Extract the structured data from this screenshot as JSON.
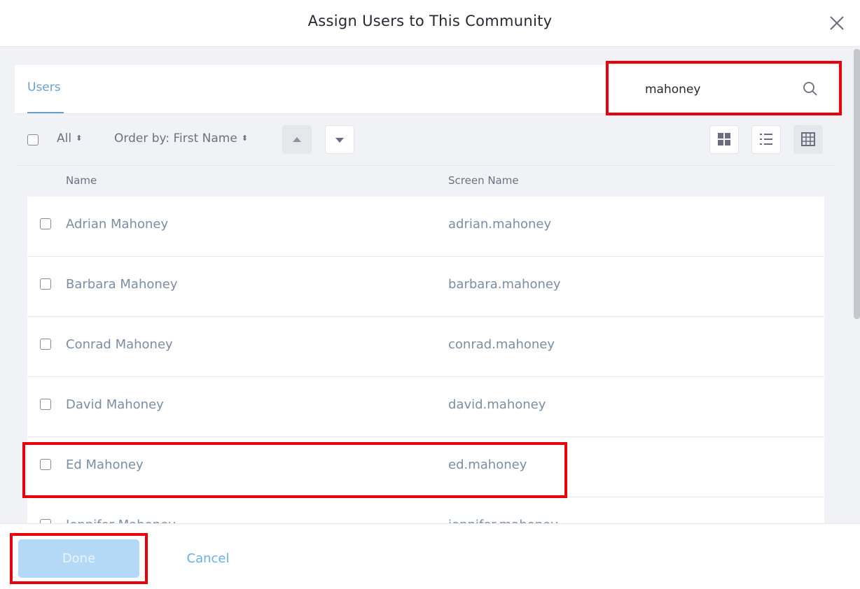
{
  "modal": {
    "title": "Assign Users to This Community"
  },
  "nav": {
    "tab_label": "Users"
  },
  "search": {
    "value": "mahoney",
    "icon": "search-icon"
  },
  "toolbar": {
    "filter_label": "All",
    "order_label": "Order by: First Name"
  },
  "table": {
    "headers": {
      "name": "Name",
      "screen_name": "Screen Name"
    },
    "rows": [
      {
        "name": "Adrian Mahoney",
        "screen_name": "adrian.mahoney"
      },
      {
        "name": "Barbara Mahoney",
        "screen_name": "barbara.mahoney"
      },
      {
        "name": "Conrad Mahoney",
        "screen_name": "conrad.mahoney"
      },
      {
        "name": "David Mahoney",
        "screen_name": "david.mahoney"
      },
      {
        "name": "Ed Mahoney",
        "screen_name": "ed.mahoney"
      },
      {
        "name": "Jennifer Mahoney",
        "screen_name": "jennifer.mahoney"
      }
    ]
  },
  "footer": {
    "done_label": "Done",
    "cancel_label": "Cancel"
  },
  "colors": {
    "accent": "#6b9fc9",
    "highlight": "#e8000b",
    "primary_disabled": "#b3d9f7"
  }
}
